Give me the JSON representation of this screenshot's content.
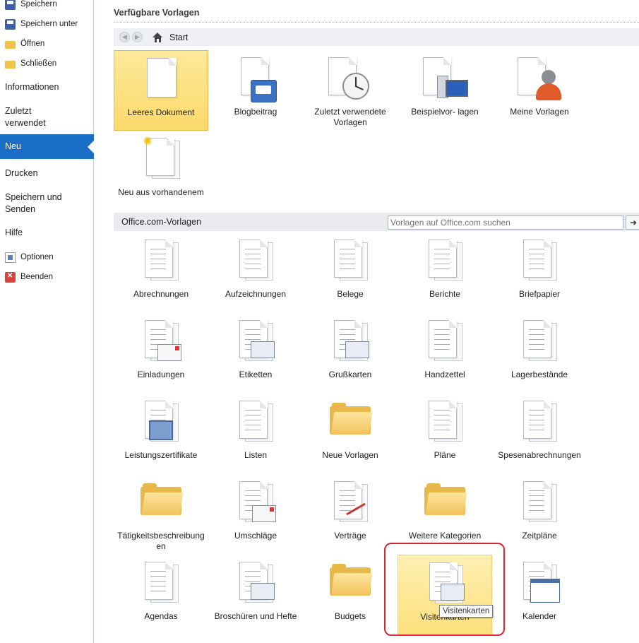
{
  "sidebar": {
    "save": "Speichern",
    "save_as": "Speichern unter",
    "open": "Öffnen",
    "close": "Schließen",
    "info": "Informationen",
    "recent": "Zuletzt verwendet",
    "new": "Neu",
    "print": "Drucken",
    "save_send": "Speichern und Senden",
    "help": "Hilfe",
    "options": "Optionen",
    "exit": "Beenden"
  },
  "available": {
    "title": "Verfügbare Vorlagen",
    "breadcrumb": "Start",
    "tiles": [
      {
        "label": "Leeres Dokument",
        "icon": "blank-document-icon"
      },
      {
        "label": "Blogbeitrag",
        "icon": "blog-post-icon"
      },
      {
        "label": "Zuletzt verwendete Vorlagen",
        "icon": "recent-templates-icon"
      },
      {
        "label": "Beispielvor- lagen",
        "icon": "sample-templates-icon"
      },
      {
        "label": "Meine Vorlagen",
        "icon": "my-templates-icon"
      },
      {
        "label": "Neu aus vorhandenem",
        "icon": "new-from-existing-icon"
      }
    ]
  },
  "office": {
    "title": "Office.com-Vorlagen",
    "search_placeholder": "Vorlagen auf Office.com suchen",
    "search_go": "➜",
    "tiles": [
      "Abrechnungen",
      "Aufzeichnungen",
      "Belege",
      "Berichte",
      "Briefpapier",
      "Einladungen",
      "Etiketten",
      "Grußkarten",
      "Handzettel",
      "Lagerbestände",
      "Leistungszertifikate",
      "Listen",
      "Neue Vorlagen",
      "Pläne",
      "Spesenabrechnungen",
      "Tätigkeitsbeschreibung en",
      "Umschläge",
      "Verträge",
      "Weitere Kategorien",
      "Zeitpläne",
      "Agendas",
      "Broschüren und Hefte",
      "Budgets",
      "Visitenkarten",
      "Kalender"
    ],
    "tooltip": "Visitenkarten"
  }
}
